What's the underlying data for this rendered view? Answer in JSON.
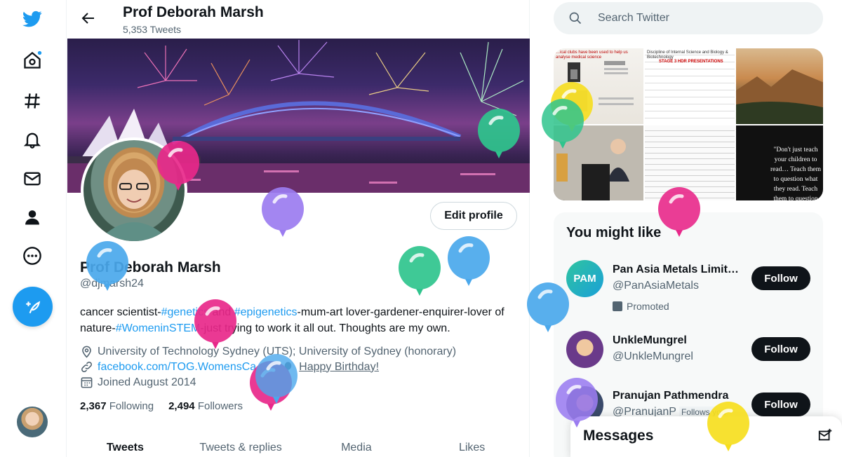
{
  "left_nav": {
    "items": [
      {
        "name": "twitter-logo-icon"
      },
      {
        "name": "home-icon"
      },
      {
        "name": "explore-hashtag-icon"
      },
      {
        "name": "notifications-bell-icon"
      },
      {
        "name": "messages-envelope-icon"
      },
      {
        "name": "profile-person-icon"
      },
      {
        "name": "more-dots-icon"
      }
    ],
    "tweet_button_icon": "feather-plus-icon"
  },
  "header": {
    "title": "Prof Deborah Marsh",
    "tweet_count": "5,353 Tweets"
  },
  "profile": {
    "edit_label": "Edit profile",
    "display_name": "Prof Deborah Marsh",
    "handle": "@djmarsh24",
    "bio": {
      "p1": "cancer scientist-",
      "l1": "#genetics",
      "p2": " and ",
      "l2": "#epigenetics",
      "p3": "-mum-art lover-gardener-enquirer-lover of nature-",
      "l3": "#WomeninSTEM",
      "p4": "-just trying to work it all out. Thoughts are my own."
    },
    "location": "University of Technology Sydney (UTS); University of Sydney (honorary)",
    "website": "facebook.com/TOG.WomensCa…",
    "birthday": "Happy Birthday!",
    "joined": "Joined August 2014",
    "following_count": "2,367",
    "following_label": "Following",
    "followers_count": "2,494",
    "followers_label": "Followers"
  },
  "tabs": [
    "Tweets",
    "Tweets & replies",
    "Media",
    "Likes"
  ],
  "search": {
    "placeholder": "Search Twitter"
  },
  "media": {
    "img1_head": "…ical clubs have been used to help us analyse medical science",
    "img2_head": "Discipline of Internal Science and Biology & Biotechnology",
    "img2_stage": "STAGE 3 HDR PRESENTATIONS",
    "img6_quote": "\"Don't just teach your children to read… Teach them to question what they read. Teach them to question everything.\""
  },
  "who_to_follow": {
    "title": "You might like",
    "suggestions": [
      {
        "name": "Pan Asia Metals Limit…",
        "handle": "@PanAsiaMetals",
        "promoted": "Promoted",
        "follow": "Follow",
        "avatar_text": "PAM"
      },
      {
        "name": "UnkleMungrel",
        "handle": "@UnkleMungrel",
        "follow": "Follow"
      },
      {
        "name": "Pranujan Pathmendra",
        "handle": "@PranujanP",
        "follows_you": "Follows you",
        "follow": "Follow"
      }
    ]
  },
  "messages": {
    "title": "Messages"
  },
  "colors": {
    "accent": "#1d9bf0",
    "balloon_blue": "#4aa8ec",
    "balloon_green": "#2fc48d",
    "balloon_pink": "#e8288a",
    "balloon_purple": "#9b7cf0",
    "balloon_yellow": "#f6de1e"
  }
}
